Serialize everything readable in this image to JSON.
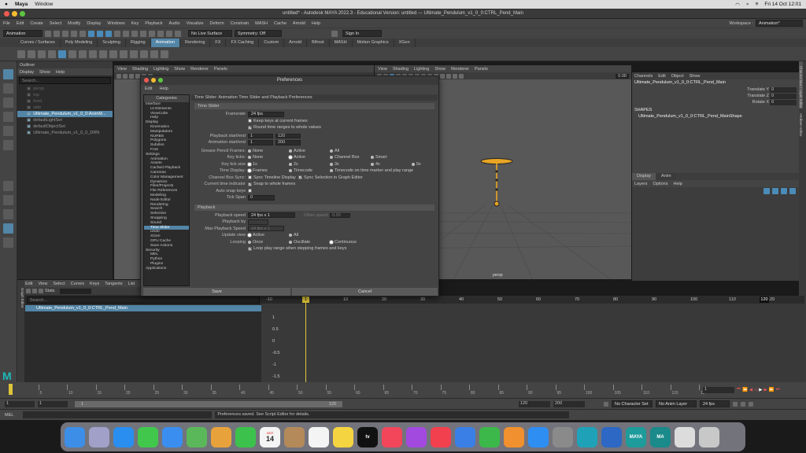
{
  "mac_menu": {
    "app": "Maya",
    "window": "Window",
    "clock": "Fri 14 Oct  12:01"
  },
  "title": "untitled* - Autodesk MAYA 2022.3 - Educational Version: untitled  ---  Ultimate_Pendulum_v1_0_0:CTRL_Pend_Main",
  "menus": [
    "File",
    "Edit",
    "Create",
    "Select",
    "Modify",
    "Display",
    "Windows",
    "Key",
    "Playback",
    "Audio",
    "Visualize",
    "Deform",
    "Constrain",
    "MASH",
    "Cache",
    "Arnold",
    "Help"
  ],
  "workspace": {
    "label": "Workspace :",
    "value": "Animation*"
  },
  "status": {
    "mode": "Animation",
    "live": "No Live Surface",
    "symmetry": "Symmetry: Off",
    "signin": "Sign In"
  },
  "shelf_tabs": [
    "Curves / Surfaces",
    "Poly Modeling",
    "Sculpting",
    "Rigging",
    "Animation",
    "Rendering",
    "FX",
    "FX Caching",
    "Custom",
    "Arnold",
    "Bifrost",
    "MASH",
    "Motion Graphics",
    "XGen"
  ],
  "shelf_active": "Animation",
  "outliner": {
    "title": "Outliner",
    "menu": [
      "Display",
      "Show",
      "Help"
    ],
    "search": "Search...",
    "items": [
      {
        "label": "persp",
        "dim": true
      },
      {
        "label": "top",
        "dim": true
      },
      {
        "label": "front",
        "dim": true
      },
      {
        "label": "side",
        "dim": true
      },
      {
        "label": "Ultimate_Pendulum_v1_0_0:AnimM...",
        "sel": true
      },
      {
        "label": "defaultLightSet"
      },
      {
        "label": "defaultObjectSet"
      },
      {
        "label": "Ultimate_Pendulum_v1_0_0_DRN"
      }
    ]
  },
  "viewport_menu": [
    "View",
    "Shading",
    "Lighting",
    "Show",
    "Renderer",
    "Panels"
  ],
  "viewport_label": "persp",
  "viewport_field": "0.00",
  "channel_box": {
    "menu": [
      "Channels",
      "Edit",
      "Object",
      "Show"
    ],
    "node": "Ultimate_Pendulum_v1_0_0:CTRL_Pend_Main",
    "attrs": [
      {
        "name": "Translate Y",
        "value": "0"
      },
      {
        "name": "Translate Z",
        "value": "0"
      },
      {
        "name": "Rotate X",
        "value": "0"
      }
    ],
    "shapes": "SHAPES",
    "shape": "Ultimate_Pendulum_v1_0_0:CTRL_Pend_MainShape"
  },
  "layer_editor": {
    "tabs": [
      "Display",
      "Anim"
    ],
    "menu": [
      "Layers",
      "Options",
      "Help"
    ]
  },
  "side_tabs": [
    "Channel Box / Layer Editor",
    "Attribute Editor"
  ],
  "graph_editor": {
    "title": "Graph Editor",
    "menu": [
      "Edit",
      "View",
      "Select",
      "Curves",
      "Keys",
      "Tangents",
      "List"
    ],
    "stats": "Stats",
    "search": "Search...",
    "item": "Ultimate_Pendulum_v1_0_0:CTRL_Pend_Main",
    "ruler": [
      "-10",
      "0",
      "10",
      "20",
      "30",
      "40",
      "50",
      "60",
      "70",
      "80",
      "90",
      "100",
      "110",
      "120"
    ],
    "yvals": [
      "1",
      "0.5",
      "0",
      "-0.5",
      "-1",
      "-1.5"
    ],
    "current": "1",
    "end": "120"
  },
  "time_slider": {
    "ticks": [
      "1",
      "5",
      "10",
      "15",
      "20",
      "25",
      "30",
      "35",
      "40",
      "45",
      "50",
      "55",
      "60",
      "65",
      "70",
      "75",
      "80",
      "85",
      "90",
      "95",
      "100",
      "105",
      "110",
      "115",
      "12"
    ],
    "current": "1"
  },
  "range": {
    "start": "1",
    "inner_start": "1",
    "inner_start2": "1",
    "inner_end": "120",
    "end": "120",
    "end2": "200",
    "character": "No Character Set",
    "anim_layer": "No Anim Layer",
    "fps": "24 fps"
  },
  "cmd": {
    "label": "MEL",
    "result": "Preferences saved. See Script Editor for details."
  },
  "prefs": {
    "title": "Preferences",
    "menu": [
      "Edit",
      "Help"
    ],
    "categories_title": "Categories",
    "categories": [
      {
        "t": "Interface",
        "l": 0
      },
      {
        "t": "UI Elements",
        "l": 1
      },
      {
        "t": "ViewCube",
        "l": 1
      },
      {
        "t": "Help",
        "l": 1
      },
      {
        "t": "Display",
        "l": 0
      },
      {
        "t": "Kinematics",
        "l": 1
      },
      {
        "t": "Manipulators",
        "l": 1
      },
      {
        "t": "NURBS",
        "l": 1
      },
      {
        "t": "Polygons",
        "l": 1
      },
      {
        "t": "Subdivs",
        "l": 1
      },
      {
        "t": "Font",
        "l": 1
      },
      {
        "t": "Settings",
        "l": 0
      },
      {
        "t": "Animation",
        "l": 1
      },
      {
        "t": "Assets",
        "l": 1
      },
      {
        "t": "Cached Playback",
        "l": 1
      },
      {
        "t": "Cameras",
        "l": 1
      },
      {
        "t": "Color Management",
        "l": 1
      },
      {
        "t": "Dynamics",
        "l": 1
      },
      {
        "t": "Files/Projects",
        "l": 1
      },
      {
        "t": "File References",
        "l": 1
      },
      {
        "t": "Modeling",
        "l": 1
      },
      {
        "t": "Node Editor",
        "l": 1
      },
      {
        "t": "Rendering",
        "l": 1
      },
      {
        "t": "Search",
        "l": 1
      },
      {
        "t": "Selection",
        "l": 1
      },
      {
        "t": "Snapping",
        "l": 1
      },
      {
        "t": "Sound",
        "l": 1
      },
      {
        "t": "Time Slider",
        "l": 1,
        "sel": true
      },
      {
        "t": "Undo",
        "l": 1
      },
      {
        "t": "XGen",
        "l": 1
      },
      {
        "t": "GPU Cache",
        "l": 1
      },
      {
        "t": "Save Actions",
        "l": 1
      },
      {
        "t": "Security",
        "l": 0
      },
      {
        "t": "MEL",
        "l": 1
      },
      {
        "t": "Python",
        "l": 1
      },
      {
        "t": "Plugins",
        "l": 1
      },
      {
        "t": "Applications",
        "l": 0
      }
    ],
    "header": "Time Slider: Animation Time Slider and Playback Preferences",
    "sec1": "Time Slider",
    "framerate_label": "Framerate",
    "framerate": "24 fps",
    "keep_keys": "Keep keys at current frames",
    "round_time": "Round time ranges to whole values",
    "playback_label": "Playback start/end",
    "pb_start": "1",
    "pb_end": "120",
    "anim_label": "Animation start/end",
    "an_start": "1",
    "an_end": "200",
    "grease_label": "Grease Pencil Frames:",
    "grease_opts": [
      "None",
      "Active",
      "All"
    ],
    "keyticks_label": "Key ticks:",
    "keyticks_opts": [
      "None",
      "Active",
      "Channel Box",
      "Smart"
    ],
    "ticksize_label": "Key tick size",
    "ticksize_opts": [
      "1x",
      "2x",
      "3x",
      "4x",
      "5x"
    ],
    "timedisplay_label": "Time Display:",
    "timedisplay_opts": [
      "Frames",
      "Timecode",
      "Timecode on time marker and play range"
    ],
    "cbsync_label": "Channel Box Sync:",
    "cbsync_opts": [
      "Sync Timeline Display",
      "Sync Selection in Graph Editor"
    ],
    "cti_label": "Current time indicator",
    "snap": "Snap to whole frames",
    "autosnap_label": "Auto snap keys",
    "tickspan_label": "Tick Span",
    "tickspan": "0",
    "sec2": "Playback",
    "pbspeed_label": "Playback speed",
    "pbspeed": "24 fps x 1",
    "other_label": "Other speed:",
    "other": "0.00",
    "pbby_label": "Playback by",
    "maxpb_label": "Max Playback Speed",
    "maxpb": "24 fps x 1",
    "update_label": "Update view",
    "update_opts": [
      "Active",
      "All"
    ],
    "loop_label": "Looping",
    "loop_opts": [
      "Once",
      "Oscillate",
      "Continuous"
    ],
    "loop_step": "Loop play range when stepping frames and keys",
    "save": "Save",
    "cancel": "Cancel"
  },
  "dock_apps": [
    {
      "n": "finder-icon",
      "c": "#3d8ee6"
    },
    {
      "n": "launchpad-icon",
      "c": "#a0a0c8"
    },
    {
      "n": "safari-icon",
      "c": "#2a8ef0"
    },
    {
      "n": "messages-icon",
      "c": "#41c84c"
    },
    {
      "n": "mail-icon",
      "c": "#3a8ef0"
    },
    {
      "n": "maps-icon",
      "c": "#5bb85a"
    },
    {
      "n": "photos-icon",
      "c": "#e8a23c"
    },
    {
      "n": "facetime-icon",
      "c": "#3cc24c"
    },
    {
      "n": "calendar-icon",
      "c": "#f4f4f4"
    },
    {
      "n": "contacts-icon",
      "c": "#b48a5a"
    },
    {
      "n": "reminders-icon",
      "c": "#f4f4f4"
    },
    {
      "n": "notes-icon",
      "c": "#f5d442"
    },
    {
      "n": "tv-icon",
      "c": "#111111"
    },
    {
      "n": "music-icon",
      "c": "#f3465a"
    },
    {
      "n": "podcasts-icon",
      "c": "#a24ae0"
    },
    {
      "n": "news-icon",
      "c": "#f2404e"
    },
    {
      "n": "keynote-icon",
      "c": "#3a7fe6"
    },
    {
      "n": "numbers-icon",
      "c": "#3cb84a"
    },
    {
      "n": "pages-icon",
      "c": "#f0902e"
    },
    {
      "n": "appstore-icon",
      "c": "#2f8ef2"
    },
    {
      "n": "settings-icon",
      "c": "#8a8a8a"
    },
    {
      "n": "edge-icon",
      "c": "#1fa2b8"
    },
    {
      "n": "word-icon",
      "c": "#2c68c4"
    },
    {
      "n": "maya-icon",
      "c": "#1e9b9b"
    },
    {
      "n": "maya2-icon",
      "c": "#1a8a8a"
    },
    {
      "n": "preview-icon",
      "c": "#dcdcdc"
    },
    {
      "n": "trash-icon",
      "c": "#c8c8c8"
    }
  ],
  "dock_labels": {
    "calendar_month": "OCT",
    "calendar_day": "14",
    "tv": "tv",
    "maya": "MAYA",
    "maya2": "MA"
  }
}
